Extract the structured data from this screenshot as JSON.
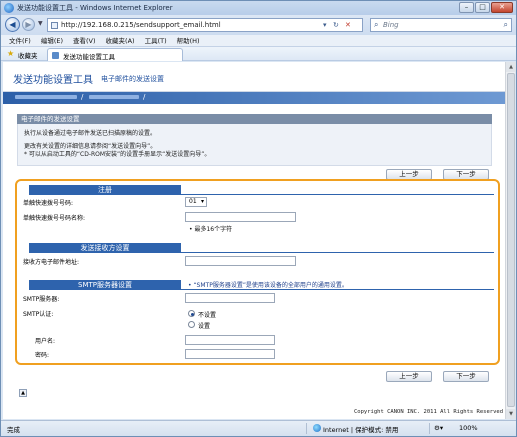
{
  "window": {
    "title": "发送功能设置工具 - Windows Internet Explorer",
    "buttons": {
      "minimize": "–",
      "maximize": "□",
      "close": "✕"
    }
  },
  "address": {
    "url": "http://192.168.0.215/sendsupport_email.html",
    "search_placeholder": "Bing"
  },
  "menu": [
    "文件(F)",
    "编辑(E)",
    "查看(V)",
    "收藏夹(A)",
    "工具(T)",
    "帮助(H)"
  ],
  "favorites": {
    "label": "收藏夹",
    "tab_title": "发送功能设置工具"
  },
  "app": {
    "title": "发送功能设置工具",
    "subtitle": "电子邮件的发送设置",
    "crumb_sep": "/"
  },
  "section": {
    "heading": "电子邮件的发送设置",
    "desc1": "执行从设备通过电子邮件发送已扫描原稿的设置。",
    "desc2": "更改有关设置的详细信息请参阅“发送设置向导”。",
    "desc3": "* 可以从启动工具的“CD-ROM安装”的设置手册显示“发送设置向导”。"
  },
  "buttons": {
    "prev": "上一步",
    "next": "下一步"
  },
  "register": {
    "heading": "注册",
    "speed_dial_label": "单触快速拨号号码:",
    "speed_dial_value": "01",
    "speed_dial_name_label": "单触快速拨号号码名称:",
    "name_hint": "• 最多16个字符"
  },
  "recipient": {
    "heading": "发送接收方设置",
    "email_label": "接收方电子邮件地址:"
  },
  "smtp": {
    "heading": "SMTP服务器设置",
    "hint": "• “SMTP服务器设置”是使用该设备的全部用户的通用设置。",
    "server_label": "SMTP服务器:",
    "auth_label": "SMTP认证:",
    "auth_options": [
      "不设置",
      "设置"
    ],
    "user_label": "用户名:",
    "password_label": "密码:"
  },
  "footer": {
    "copyright": "Copyright CANON INC. 2011 All Rights Reserved",
    "top_icon": "▲"
  },
  "status": {
    "done": "完成",
    "zone": "Internet | 保护模式: 禁用",
    "zoom": "100%"
  }
}
